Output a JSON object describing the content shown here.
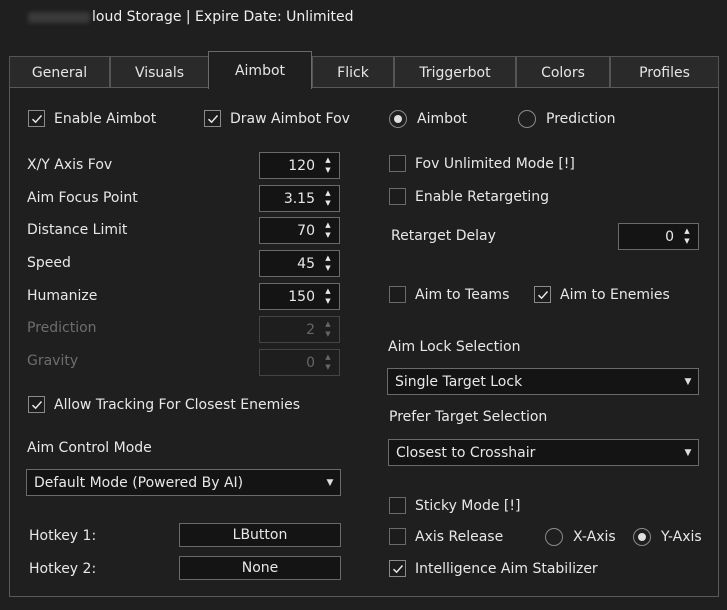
{
  "window": {
    "title_suffix": "loud Storage | Expire Date: Unlimited"
  },
  "tabs": [
    {
      "label": "General",
      "active": false
    },
    {
      "label": "Visuals",
      "active": false
    },
    {
      "label": "Aimbot",
      "active": true
    },
    {
      "label": "Flick",
      "active": false
    },
    {
      "label": "Triggerbot",
      "active": false
    },
    {
      "label": "Colors",
      "active": false
    },
    {
      "label": "Profiles",
      "active": false
    }
  ],
  "left": {
    "enable_aimbot": {
      "label": "Enable Aimbot",
      "checked": true
    },
    "draw_fov": {
      "label": "Draw Aimbot Fov",
      "checked": true
    },
    "fields": [
      {
        "label": "X/Y Axis Fov",
        "value": "120",
        "enabled": true
      },
      {
        "label": "Aim Focus Point",
        "value": "3.15",
        "enabled": true
      },
      {
        "label": "Distance Limit",
        "value": "70",
        "enabled": true
      },
      {
        "label": "Speed",
        "value": "45",
        "enabled": true
      },
      {
        "label": "Humanize",
        "value": "150",
        "enabled": true
      },
      {
        "label": "Prediction",
        "value": "2",
        "enabled": false
      },
      {
        "label": "Gravity",
        "value": "0",
        "enabled": false
      }
    ],
    "allow_tracking": {
      "label": "Allow Tracking For Closest Enemies",
      "checked": true
    },
    "aim_control_mode": {
      "label": "Aim Control Mode",
      "selected": "Default Mode (Powered By AI)"
    },
    "hotkey1": {
      "label": "Hotkey 1:",
      "value": "LButton"
    },
    "hotkey2": {
      "label": "Hotkey 2:",
      "value": "None"
    }
  },
  "right": {
    "mode_aimbot": {
      "label": "Aimbot",
      "selected": true
    },
    "mode_prediction": {
      "label": "Prediction",
      "selected": false
    },
    "fov_unlimited": {
      "label": "Fov Unlimited Mode [!]",
      "checked": false
    },
    "enable_retargeting": {
      "label": "Enable Retargeting",
      "checked": false
    },
    "retarget_delay": {
      "label": "Retarget Delay",
      "value": "0"
    },
    "aim_to_teams": {
      "label": "Aim to Teams",
      "checked": false
    },
    "aim_to_enemies": {
      "label": "Aim to Enemies",
      "checked": true
    },
    "aim_lock": {
      "label": "Aim Lock Selection",
      "selected": "Single Target Lock"
    },
    "prefer_target": {
      "label": "Prefer Target Selection",
      "selected": "Closest to Crosshair"
    },
    "sticky_mode": {
      "label": "Sticky Mode [!]",
      "checked": false
    },
    "axis_release": {
      "label": "Axis Release",
      "checked": false
    },
    "x_axis": {
      "label": "X-Axis",
      "selected": false
    },
    "y_axis": {
      "label": "Y-Axis",
      "selected": true
    },
    "intelligence": {
      "label": "Intelligence Aim Stabilizer",
      "checked": true
    }
  }
}
